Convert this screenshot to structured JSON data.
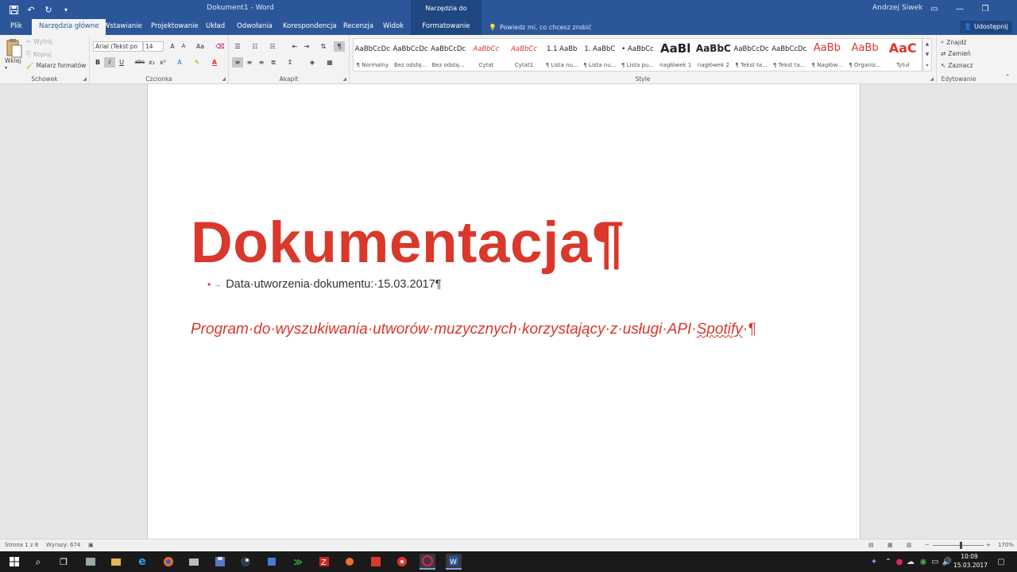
{
  "window": {
    "title": "Dokument1 - Word",
    "drawing_tools": "Narzędzia do rysowania",
    "user": "Andrzej Siwek"
  },
  "tabs": [
    {
      "label": "Plik"
    },
    {
      "label": "Narzędzia główne"
    },
    {
      "label": "Wstawianie"
    },
    {
      "label": "Projektowanie"
    },
    {
      "label": "Układ"
    },
    {
      "label": "Odwołania"
    },
    {
      "label": "Korespondencja"
    },
    {
      "label": "Recenzja"
    },
    {
      "label": "Widok"
    },
    {
      "label": "Formatowanie"
    }
  ],
  "tellme": "Powiedz mi, co chcesz zrobić",
  "share": "Udostępnij",
  "clipboard": {
    "paste": "Wklej",
    "cut": "Wytnij",
    "copy": "Kopiuj",
    "painter": "Malarz formatów",
    "label": "Schowek"
  },
  "font": {
    "name": "Arial (Tekst po",
    "size": "14",
    "grow": "A",
    "shrink": "A",
    "case": "Aa",
    "bold": "B",
    "italic": "I",
    "underline": "U",
    "strike": "abc",
    "sub": "x₂",
    "sup": "x²",
    "label": "Czcionka"
  },
  "paragraph": {
    "label": "Akapit"
  },
  "styles": {
    "label": "Style",
    "items": [
      {
        "preview": "AaBbCcDc",
        "name": "¶ Normalny"
      },
      {
        "preview": "AaBbCcDc",
        "name": "Bez odstę..."
      },
      {
        "preview": "AaBbCcDc",
        "name": "Bez odstę..."
      },
      {
        "preview": "AaBbCc",
        "name": "Cytat"
      },
      {
        "preview": "AaBbCc",
        "name": "Cytat1"
      },
      {
        "preview": "1.1 AaBb",
        "name": "¶ Lista nu..."
      },
      {
        "preview": "1. AaBbC",
        "name": "¶ Lista nu..."
      },
      {
        "preview": "• AaBbCc",
        "name": "¶ Lista pu..."
      },
      {
        "preview": "AaBl",
        "name": "nagłówek 1"
      },
      {
        "preview": "AaBbC",
        "name": "nagłówek 2"
      },
      {
        "preview": "AaBbCcDc",
        "name": "¶ Tekst ta..."
      },
      {
        "preview": "AaBbCcDc",
        "name": "¶ Tekst ta..."
      },
      {
        "preview": "AaBb",
        "name": "¶ Nagłów..."
      },
      {
        "preview": "AaBb",
        "name": "¶ Organiz..."
      },
      {
        "preview": "AaC",
        "name": "Tytuł"
      }
    ]
  },
  "editing": {
    "find": "Znajdź",
    "replace": "Zamień",
    "select": "Zaznacz",
    "label": "Edytowanie"
  },
  "document": {
    "title": "Dokumentacja¶",
    "bullet": "Data·utworzenia·dokumentu:·15.03.2017¶",
    "subtitle_part1": "Program·do·wyszukiwania·utworów·muzycznych·korzystający·z·usługi·API·",
    "subtitle_word": "Spotify",
    "subtitle_end": "·¶"
  },
  "status": {
    "page": "Strona 1 z 8",
    "words": "Wyrazy: 674",
    "zoom": "170%"
  },
  "clock": {
    "time": "10:09",
    "date": "15.03.2017"
  },
  "colors": {
    "accent": "#2b579a",
    "title_red": "#d9382b"
  }
}
